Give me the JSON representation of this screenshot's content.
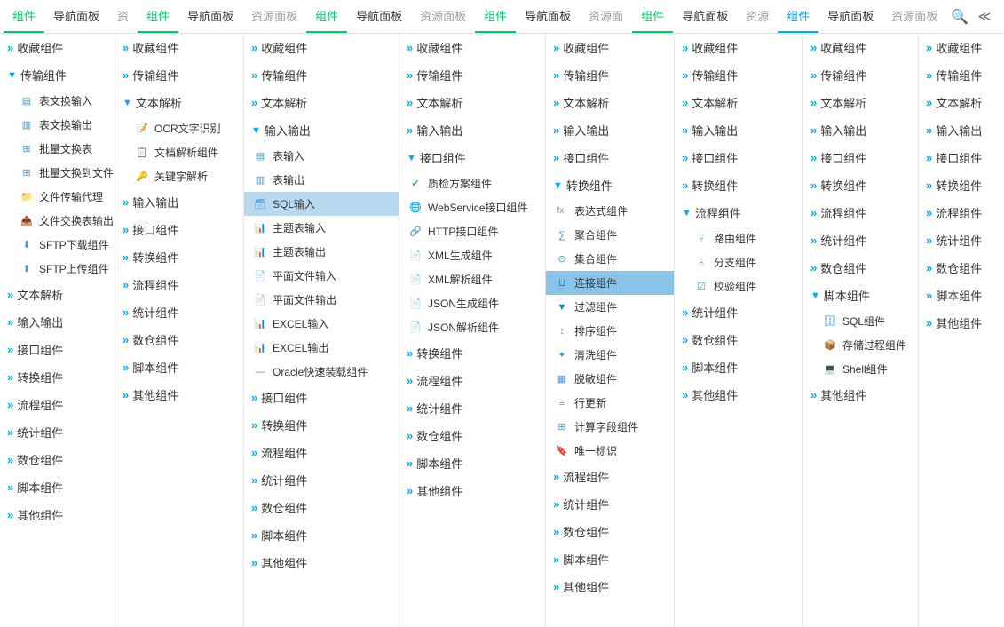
{
  "nav": {
    "tabs": [
      {
        "label": "组件",
        "type": "active-green",
        "id": "tab1"
      },
      {
        "label": "导航面板",
        "type": "normal",
        "id": "tab1b"
      },
      {
        "label": "资",
        "type": "normal",
        "id": "tab1c"
      },
      {
        "label": "组件",
        "type": "active-green",
        "id": "tab2"
      },
      {
        "label": "导航面板",
        "type": "normal",
        "id": "tab2b"
      },
      {
        "label": "资源面板",
        "type": "normal",
        "id": "tab2c"
      },
      {
        "label": "组件",
        "type": "active-green",
        "id": "tab3"
      },
      {
        "label": "导航面板",
        "type": "normal",
        "id": "tab3b"
      },
      {
        "label": "资源面板",
        "type": "normal",
        "id": "tab3c"
      },
      {
        "label": "组件",
        "type": "active-green",
        "id": "tab4"
      },
      {
        "label": "导航面板",
        "type": "normal",
        "id": "tab4b"
      },
      {
        "label": "资源面",
        "type": "normal",
        "id": "tab4c"
      },
      {
        "label": "组件",
        "type": "active-green",
        "id": "tab5"
      },
      {
        "label": "导航面板",
        "type": "normal",
        "id": "tab5b"
      },
      {
        "label": "资源",
        "type": "normal",
        "id": "tab5c"
      },
      {
        "label": "组件",
        "type": "active-blue",
        "id": "tab6"
      },
      {
        "label": "导航面板",
        "type": "normal",
        "id": "tab6b"
      },
      {
        "label": "资源面板",
        "type": "normal",
        "id": "tab6c"
      }
    ],
    "search_icon": "🔍",
    "collapse_icon": "≪"
  },
  "col1": {
    "sections": [
      {
        "label": "收藏组件",
        "type": "dbl"
      },
      {
        "label": "传输组件",
        "type": "expand",
        "expanded": true
      },
      {
        "label": "表文换输入",
        "type": "item"
      },
      {
        "label": "表文换输出",
        "type": "item"
      },
      {
        "label": "批量文换表",
        "type": "item"
      },
      {
        "label": "批量文换到文件",
        "type": "item"
      },
      {
        "label": "文件传输代理",
        "type": "item"
      },
      {
        "label": "文件交换表输出",
        "type": "item"
      },
      {
        "label": "SFTP下载组件",
        "type": "item"
      },
      {
        "label": "SFTP上传组件",
        "type": "item"
      },
      {
        "label": "文本解析",
        "type": "dbl"
      },
      {
        "label": "输入输出",
        "type": "dbl"
      },
      {
        "label": "接口组件",
        "type": "dbl"
      },
      {
        "label": "转换组件",
        "type": "dbl"
      },
      {
        "label": "流程组件",
        "type": "dbl"
      },
      {
        "label": "统计组件",
        "type": "dbl"
      },
      {
        "label": "数仓组件",
        "type": "dbl"
      },
      {
        "label": "脚本组件",
        "type": "dbl"
      },
      {
        "label": "其他组件",
        "type": "dbl"
      }
    ]
  },
  "col2": {
    "sections": [
      {
        "label": "收藏组件",
        "type": "dbl"
      },
      {
        "label": "传输组件",
        "type": "dbl"
      },
      {
        "label": "文本解析",
        "type": "expand",
        "expanded": true
      },
      {
        "label": "OCR文字识别",
        "type": "item"
      },
      {
        "label": "文档解析组件",
        "type": "item"
      },
      {
        "label": "关键字解析",
        "type": "item"
      },
      {
        "label": "输入输出",
        "type": "dbl"
      },
      {
        "label": "接口组件",
        "type": "dbl"
      },
      {
        "label": "转换组件",
        "type": "dbl"
      },
      {
        "label": "流程组件",
        "type": "dbl"
      },
      {
        "label": "统计组件",
        "type": "dbl"
      },
      {
        "label": "数仓组件",
        "type": "dbl"
      },
      {
        "label": "脚本组件",
        "type": "dbl"
      },
      {
        "label": "其他组件",
        "type": "dbl"
      }
    ]
  },
  "col3": {
    "popup": {
      "title": "输入输出",
      "items": [
        {
          "label": "表输入",
          "type": "item"
        },
        {
          "label": "表输出",
          "type": "item"
        },
        {
          "label": "SQL输入",
          "type": "item",
          "highlight": true
        },
        {
          "label": "主题表输入",
          "type": "item"
        },
        {
          "label": "主题表输出",
          "type": "item"
        },
        {
          "label": "平面文件输入",
          "type": "item"
        },
        {
          "label": "平面文件输出",
          "type": "item"
        },
        {
          "label": "EXCEL输入",
          "type": "item"
        },
        {
          "label": "EXCEL输出",
          "type": "item"
        },
        {
          "label": "Oracle快速装载组件",
          "type": "item"
        }
      ]
    },
    "sections": [
      {
        "label": "收藏组件",
        "type": "dbl"
      },
      {
        "label": "传输组件",
        "type": "dbl"
      },
      {
        "label": "文本解析",
        "type": "dbl"
      },
      {
        "label": "输入输出",
        "type": "expand"
      },
      {
        "label": "接口组件",
        "type": "dbl"
      },
      {
        "label": "转换组件",
        "type": "dbl"
      },
      {
        "label": "流程组件",
        "type": "dbl"
      },
      {
        "label": "统计组件",
        "type": "dbl"
      },
      {
        "label": "数仓组件",
        "type": "dbl"
      },
      {
        "label": "脚本组件",
        "type": "dbl"
      },
      {
        "label": "其他组件",
        "type": "dbl"
      }
    ]
  },
  "col4": {
    "popup": {
      "title": "接口组件",
      "items": [
        {
          "label": "质检方案组件",
          "type": "item"
        },
        {
          "label": "WebService接口组件",
          "type": "item"
        },
        {
          "label": "HTTP接口组件",
          "type": "item"
        },
        {
          "label": "XML生成组件",
          "type": "item"
        },
        {
          "label": "XML解析组件",
          "type": "item"
        },
        {
          "label": "JSON生成组件",
          "type": "item"
        },
        {
          "label": "JSON解析组件",
          "type": "item"
        }
      ]
    },
    "sections": [
      {
        "label": "收藏组件",
        "type": "dbl"
      },
      {
        "label": "传输组件",
        "type": "dbl"
      },
      {
        "label": "文本解析",
        "type": "dbl"
      },
      {
        "label": "输入输出",
        "type": "dbl"
      },
      {
        "label": "接口组件",
        "type": "expand"
      },
      {
        "label": "转换组件",
        "type": "dbl"
      },
      {
        "label": "流程组件",
        "type": "dbl"
      },
      {
        "label": "统计组件",
        "type": "dbl"
      },
      {
        "label": "数仓组件",
        "type": "dbl"
      },
      {
        "label": "脚本组件",
        "type": "dbl"
      },
      {
        "label": "其他组件",
        "type": "dbl"
      }
    ]
  },
  "col5": {
    "popup": {
      "title": "转换组件",
      "items": [
        {
          "label": "表达式组件",
          "type": "item"
        },
        {
          "label": "聚合组件",
          "type": "item"
        },
        {
          "label": "集合组件",
          "type": "item"
        },
        {
          "label": "连接组件",
          "type": "item",
          "selected": true
        },
        {
          "label": "过滤组件",
          "type": "item"
        },
        {
          "label": "排序组件",
          "type": "item"
        },
        {
          "label": "清洗组件",
          "type": "item"
        },
        {
          "label": "脱敏组件",
          "type": "item"
        },
        {
          "label": "行更新",
          "type": "item"
        },
        {
          "label": "计算字段组件",
          "type": "item"
        },
        {
          "label": "唯一标识",
          "type": "item"
        }
      ]
    },
    "sections": [
      {
        "label": "收藏组件",
        "type": "dbl"
      },
      {
        "label": "传输组件",
        "type": "dbl"
      },
      {
        "label": "文本解析",
        "type": "dbl"
      },
      {
        "label": "输入输出",
        "type": "dbl"
      },
      {
        "label": "接口组件",
        "type": "dbl"
      },
      {
        "label": "转换组件",
        "type": "expand"
      },
      {
        "label": "流程组件",
        "type": "dbl"
      },
      {
        "label": "统计组件",
        "type": "dbl"
      },
      {
        "label": "数仓组件",
        "type": "dbl"
      },
      {
        "label": "脚本组件",
        "type": "dbl"
      },
      {
        "label": "其他组件",
        "type": "dbl"
      }
    ]
  },
  "col6": {
    "sections": [
      {
        "label": "收藏组件",
        "type": "dbl"
      },
      {
        "label": "传输组件",
        "type": "dbl"
      },
      {
        "label": "文本解析",
        "type": "dbl"
      },
      {
        "label": "输入输出",
        "type": "dbl"
      },
      {
        "label": "接口组件",
        "type": "dbl"
      },
      {
        "label": "转换组件",
        "type": "dbl"
      },
      {
        "label": "流程组件",
        "type": "expand",
        "expanded": true
      },
      {
        "label": "路由组件",
        "type": "item"
      },
      {
        "label": "分支组件",
        "type": "item"
      },
      {
        "label": "校验组件",
        "type": "item"
      },
      {
        "label": "统计组件",
        "type": "dbl"
      },
      {
        "label": "数仓组件",
        "type": "dbl"
      },
      {
        "label": "脚本组件",
        "type": "dbl"
      },
      {
        "label": "其他组件",
        "type": "dbl"
      }
    ]
  },
  "col7": {
    "sections": [
      {
        "label": "收藏组件",
        "type": "dbl"
      },
      {
        "label": "传输组件",
        "type": "dbl"
      },
      {
        "label": "文本解析",
        "type": "dbl"
      },
      {
        "label": "输入输出",
        "type": "dbl"
      },
      {
        "label": "接口组件",
        "type": "dbl"
      },
      {
        "label": "转换组件",
        "type": "dbl"
      },
      {
        "label": "流程组件",
        "type": "dbl"
      },
      {
        "label": "统计组件",
        "type": "dbl"
      },
      {
        "label": "数仓组件",
        "type": "dbl"
      },
      {
        "label": "脚本组件",
        "type": "expand",
        "expanded": true
      },
      {
        "label": "SQL组件",
        "type": "item"
      },
      {
        "label": "存储过程组件",
        "type": "item"
      },
      {
        "label": "Shell组件",
        "type": "item"
      },
      {
        "label": "其他组件",
        "type": "dbl"
      }
    ]
  },
  "col8": {
    "sections": [
      {
        "label": "收藏组件",
        "type": "dbl"
      },
      {
        "label": "传输组件",
        "type": "dbl"
      },
      {
        "label": "文本解析",
        "type": "dbl"
      },
      {
        "label": "输入输出",
        "type": "dbl"
      },
      {
        "label": "接口组件",
        "type": "dbl"
      },
      {
        "label": "转换组件",
        "type": "dbl"
      },
      {
        "label": "流程组件",
        "type": "dbl"
      },
      {
        "label": "统计组件",
        "type": "dbl"
      },
      {
        "label": "数仓组件",
        "type": "dbl"
      },
      {
        "label": "脚本组件",
        "type": "dbl"
      },
      {
        "label": "其他组件",
        "type": "dbl"
      }
    ]
  },
  "icons": {
    "table_in": "▤",
    "table_out": "▥",
    "batch": "⊞",
    "file": "📄",
    "sftp": "⬇",
    "sftp_up": "⬆",
    "ocr": "📝",
    "doc": "📋",
    "key": "🔑",
    "sql": "🗃",
    "table": "📊",
    "flat": "📄",
    "excel": "📊",
    "oracle": "⚙",
    "quality": "✔",
    "webservice": "🌐",
    "http": "🔗",
    "xml": "📄",
    "json": "{ }",
    "formula": "fx",
    "aggregate": "∑",
    "set": "⊙",
    "connect": "⊔",
    "filter": "▼",
    "sort": "↕",
    "clean": "✦",
    "desens": "▦",
    "row": "≡",
    "calc": "🖩",
    "unique": "🔖",
    "route": "⑂",
    "branch": "⑃",
    "check": "☑",
    "sql_comp": "🗄",
    "stored": "📦",
    "shell": "💻"
  }
}
